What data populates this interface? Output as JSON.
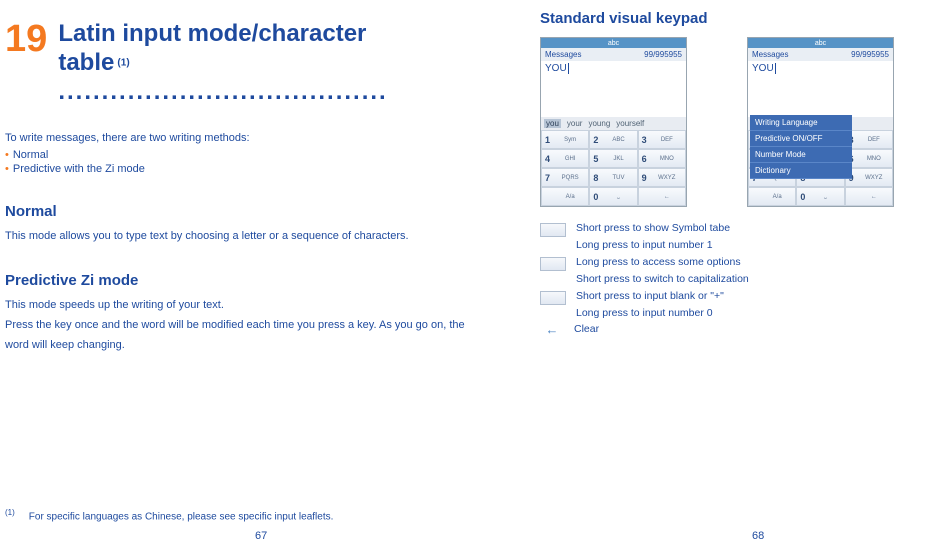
{
  "left": {
    "chapter_num": "19",
    "chapter_title_line1": "Latin input mode/character",
    "chapter_title_line2": "table",
    "chapter_sup": "(1)",
    "chapter_dots": "......................................",
    "intro": "To write messages, there are two writing methods:",
    "bullets": [
      "Normal",
      "Predictive with the Zi mode"
    ],
    "section_normal_title": "Normal",
    "section_normal_text": "This mode allows you to type text by choosing a letter or a sequence of characters.",
    "section_pred_title": "Predictive Zi mode",
    "section_pred_text1": "This mode speeds up the writing of your text.",
    "section_pred_text2": "Press the key once and the word will be modified each time you press a key. As you go on, the word will keep changing.",
    "footnote_sup": "(1)",
    "footnote_text": "For specific languages as Chinese, please see specific input leaflets.",
    "page_num": "67"
  },
  "right": {
    "heading": "Standard visual keypad",
    "screenshot": {
      "status_abc": "abc",
      "title": "Messages",
      "counter": "99/995955",
      "typed": "YOU",
      "predictions": [
        "you",
        "your",
        "young",
        "yourself"
      ],
      "keys": [
        {
          "n": "1",
          "l": "Sym"
        },
        {
          "n": "2",
          "l": "ABC"
        },
        {
          "n": "3",
          "l": "DEF"
        },
        {
          "n": "4",
          "l": "GHI"
        },
        {
          "n": "5",
          "l": "JKL"
        },
        {
          "n": "6",
          "l": "MNO"
        },
        {
          "n": "7",
          "l": "PQRS"
        },
        {
          "n": "8",
          "l": "TUV"
        },
        {
          "n": "9",
          "l": "WXYZ"
        },
        {
          "n": "",
          "l": "A/a"
        },
        {
          "n": "0",
          "l": "⎵"
        },
        {
          "n": "",
          "l": "←"
        }
      ],
      "menu_items": [
        "Writing Language",
        "Predictive ON/OFF",
        "Number Mode",
        "Dictionary"
      ]
    },
    "hints": [
      "Short press to show Symbol tabe",
      "Long press to input number 1",
      "Long press to access some options",
      "Short press to switch to capitalization",
      "Short press to input blank or \"+\"",
      "Long press to input number 0",
      "Clear"
    ],
    "page_num": "68"
  }
}
